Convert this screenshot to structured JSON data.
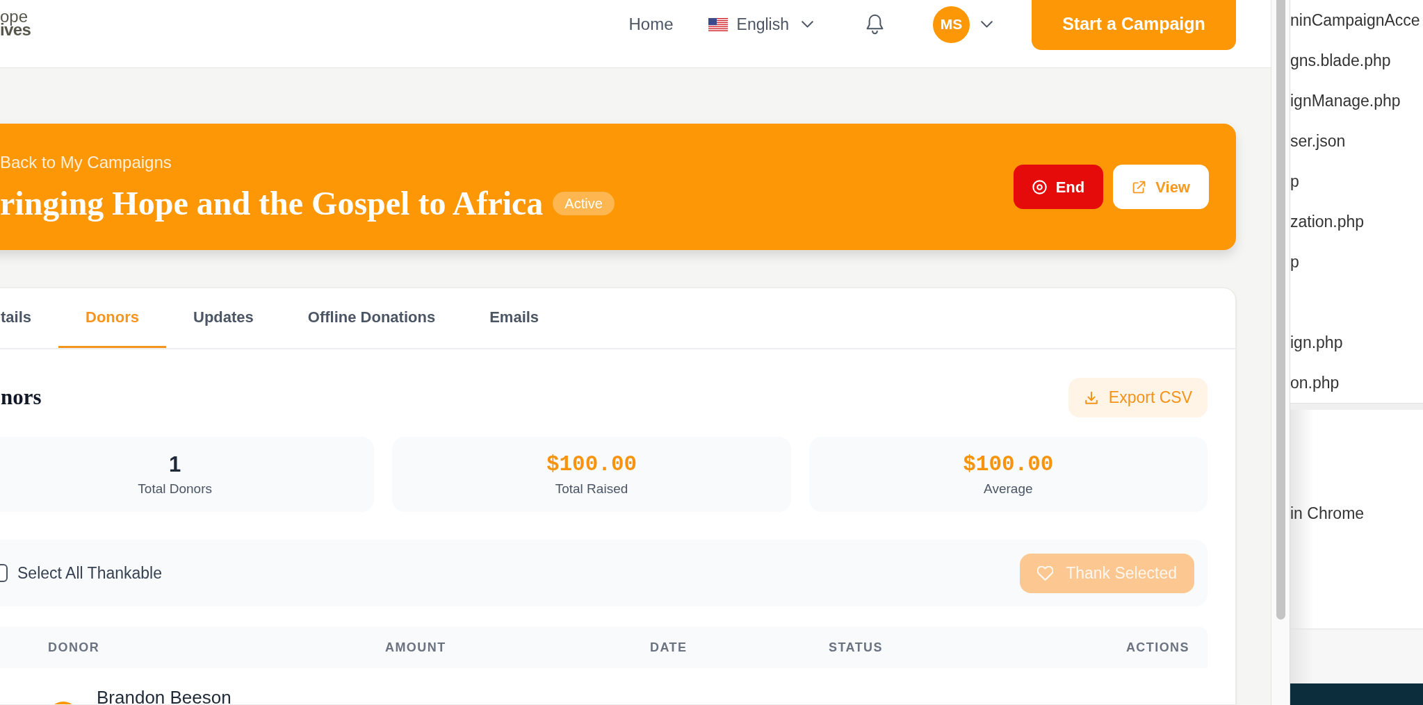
{
  "header": {
    "logo": [
      "ope",
      "ives"
    ],
    "nav": [
      {
        "label": "Home"
      }
    ],
    "language": "English",
    "avatar_initials": "MS",
    "cta_button": "Start a Campaign"
  },
  "banner": {
    "back_link": "Back to My Campaigns",
    "title": "ringing Hope and the Gospel to Africa",
    "status": "Active",
    "actions": [
      {
        "label": "End",
        "kind": "danger"
      },
      {
        "label": "View",
        "kind": "outline"
      }
    ]
  },
  "tabs": [
    {
      "label": "tails",
      "selected": false
    },
    {
      "label": "Donors",
      "selected": true
    },
    {
      "label": "Updates",
      "selected": false
    },
    {
      "label": "Offline Donations",
      "selected": false
    },
    {
      "label": "Emails",
      "selected": false
    }
  ],
  "donors": {
    "heading": "nors",
    "export_button": "Export CSV",
    "stats": [
      {
        "value": "1",
        "label": "Total Donors",
        "kind": "count"
      },
      {
        "value": "$100.00",
        "label": "Total Raised",
        "kind": "money"
      },
      {
        "value": "$100.00",
        "label": "Average",
        "kind": "money"
      }
    ],
    "select_all": {
      "label": "Select All Thankable",
      "checked": false
    },
    "thank_button": {
      "label": "Thank Selected",
      "disabled": true
    },
    "table": {
      "columns": [
        "DONOR",
        "AMOUNT",
        "DATE",
        "STATUS",
        "ACTIONS"
      ],
      "rows": [
        {
          "donor": "Brandon Beeson"
        }
      ]
    }
  },
  "side_panel": {
    "groups": [
      {
        "items": [
          "ninCampaignAcce",
          "gns.blade.php",
          "ignManage.php",
          "ser.json",
          "p",
          "zation.php",
          "p"
        ]
      },
      {
        "items": [
          "ign.php",
          "on.php"
        ]
      }
    ],
    "footer_item": "in Chrome"
  }
}
